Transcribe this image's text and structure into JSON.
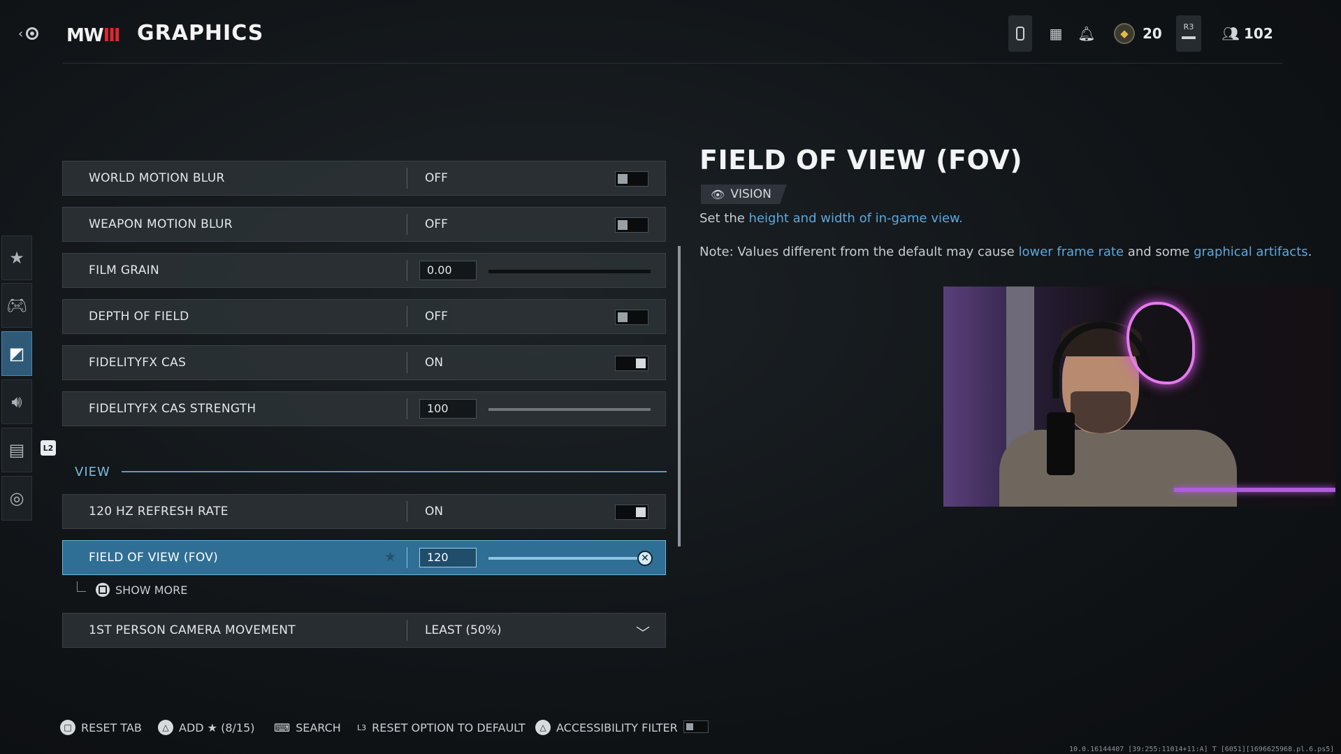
{
  "header": {
    "game_logo": "MW",
    "title": "GRAPHICS",
    "cod_points": "20",
    "r3_label": "R3",
    "party_count": "102",
    "icons": [
      "back-icon",
      "phone-icon",
      "grid-icon",
      "bell-icon",
      "cod-points-icon",
      "r3-button-icon",
      "party-icon"
    ]
  },
  "sidebar": {
    "items": [
      {
        "icon": "star-icon",
        "active": false
      },
      {
        "icon": "controller-icon",
        "active": false
      },
      {
        "icon": "graphics-icon",
        "active": true
      },
      {
        "icon": "speaker-icon",
        "active": false
      },
      {
        "icon": "interface-icon",
        "active": false
      },
      {
        "icon": "network-icon",
        "active": false
      }
    ],
    "l2_badge": "L2"
  },
  "settings": {
    "world_motion_blur": {
      "label": "WORLD MOTION BLUR",
      "value": "OFF"
    },
    "weapon_motion_blur": {
      "label": "WEAPON MOTION BLUR",
      "value": "OFF"
    },
    "film_grain": {
      "label": "FILM GRAIN",
      "value": "0.00",
      "slider_fraction": 0
    },
    "depth_of_field": {
      "label": "DEPTH OF FIELD",
      "value": "OFF"
    },
    "fidelityfx_cas": {
      "label": "FIDELITYFX CAS",
      "value": "ON"
    },
    "fidelityfx_cas_strength": {
      "label": "FIDELITYFX CAS STRENGTH",
      "value": "100",
      "slider_fraction": 1
    },
    "view_section": "VIEW",
    "refresh_120hz": {
      "label": "120 HZ REFRESH RATE",
      "value": "ON"
    },
    "fov": {
      "label": "FIELD OF VIEW (FOV)",
      "value": "120",
      "slider_fraction": 1,
      "favorite": "★"
    },
    "show_more": "SHOW MORE",
    "camera_movement": {
      "label": "1ST PERSON CAMERA MOVEMENT",
      "value": "LEAST (50%)"
    }
  },
  "description": {
    "title": "FIELD OF VIEW (FOV)",
    "tag": "VISION",
    "line1_prefix": "Set the ",
    "line1_highlight": "height and width of in-game view.",
    "line2_prefix": "Note: Values different from the default may cause ",
    "line2_highlight1": "lower frame rate",
    "line2_mid": " and some ",
    "line2_highlight2": "graphical artifacts",
    "line2_suffix": "."
  },
  "footer": {
    "reset_tab": "RESET TAB",
    "add_favorite": "ADD ★ (8/15)",
    "search": "SEARCH",
    "l3_label": "L3",
    "reset_option": "RESET OPTION TO DEFAULT",
    "accessibility_filter": "ACCESSIBILITY FILTER",
    "build_string": "10.0.16144407 [39:255:11014+11:A] T [6051][1696625968.pl.6.ps5]"
  },
  "colors": {
    "accent_blue": "#2f6f95",
    "highlight_text": "#5ea8dc",
    "logo_red": "#e0282e"
  }
}
